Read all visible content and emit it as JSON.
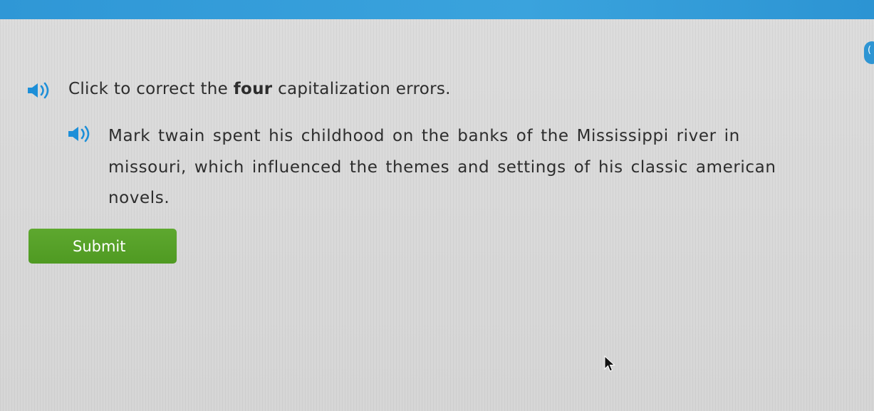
{
  "header": {
    "bar_color": "#2f97d6"
  },
  "corner_badge": {
    "glyph": "("
  },
  "instruction": {
    "speaker_icon": "speaker-icon",
    "prefix": "Click to correct the ",
    "emphasis": "four",
    "suffix": " capitalization errors."
  },
  "passage": {
    "speaker_icon": "speaker-icon",
    "lines": [
      [
        "Mark",
        "twain",
        "spent",
        "his",
        "childhood",
        "on",
        "the",
        "banks",
        "of",
        "the",
        "Mississippi",
        "river",
        "in"
      ],
      [
        "missouri,",
        "which",
        "influenced",
        "the",
        "themes",
        "and",
        "settings",
        "of",
        "his",
        "classic",
        "american"
      ],
      [
        "novels."
      ]
    ]
  },
  "submit": {
    "label": "Submit",
    "color": "#58a22a"
  },
  "cursor": {
    "icon": "mouse-pointer-icon"
  }
}
